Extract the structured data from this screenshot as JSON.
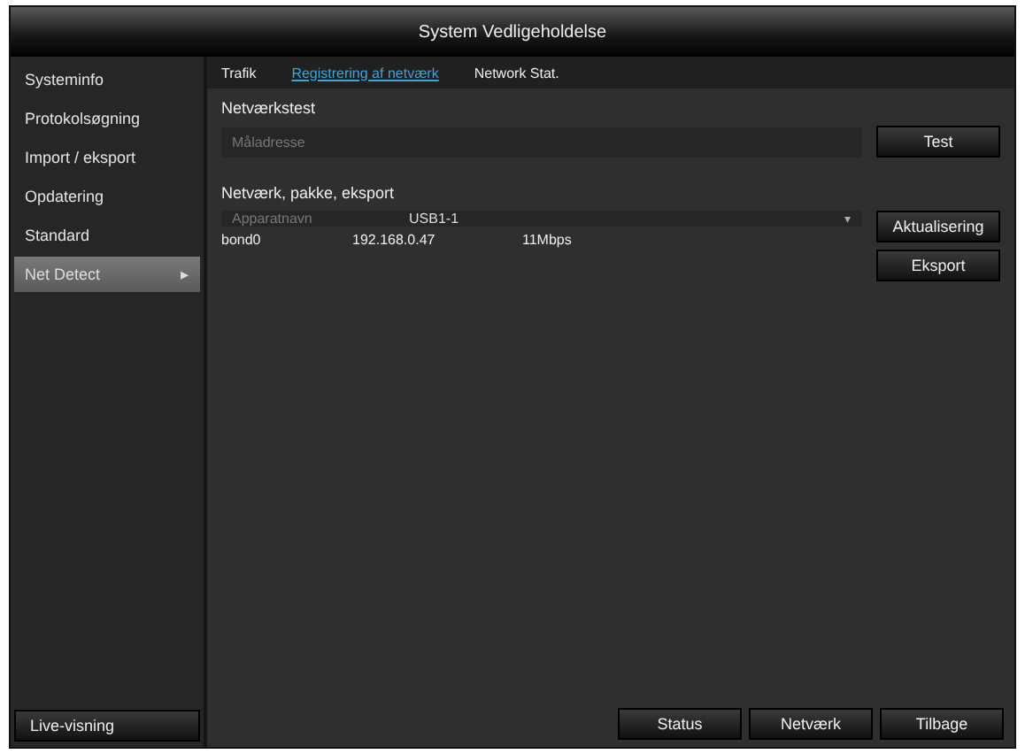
{
  "window": {
    "title": "System Vedligeholdelse"
  },
  "sidebar": {
    "items": [
      {
        "label": "Systeminfo",
        "selected": false
      },
      {
        "label": "Protokolsøgning",
        "selected": false
      },
      {
        "label": "Import / eksport",
        "selected": false
      },
      {
        "label": "Opdatering",
        "selected": false
      },
      {
        "label": "Standard",
        "selected": false
      },
      {
        "label": "Net Detect",
        "selected": true,
        "arrow": "▸"
      }
    ],
    "footer_button": "Live-visning"
  },
  "tabs": [
    {
      "label": "Trafik",
      "selected": false
    },
    {
      "label": "Registrering af netværk",
      "selected": true
    },
    {
      "label": "Network Stat.",
      "selected": false
    }
  ],
  "network_test": {
    "heading": "Netværkstest",
    "placeholder": "Måladresse",
    "button": "Test"
  },
  "export": {
    "heading": "Netværk, pakke, eksport",
    "device_label": "Apparatnavn",
    "device_value": "USB1-1",
    "caret": "▾",
    "buttons": [
      "Aktualisering",
      "Eksport"
    ],
    "rows": [
      {
        "interface": "bond0",
        "address": "192.168.0.47",
        "speed": "11Mbps"
      }
    ]
  },
  "bottom_buttons": [
    "Status",
    "Netværk",
    "Tilbage"
  ]
}
